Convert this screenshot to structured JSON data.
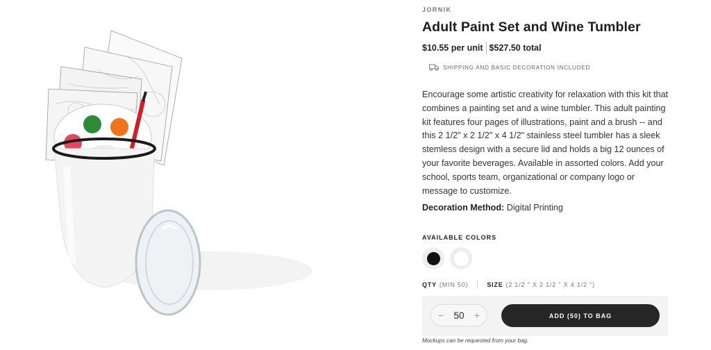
{
  "product": {
    "brand": "JORNIK",
    "title": "Adult Paint Set and Wine Tumbler",
    "unit_price": "$10.55 per unit",
    "total_price": "$527.50 total",
    "shipping_note": "SHIPPING AND BASIC DECORATION INCLUDED",
    "description": "Encourage some artistic creativity for relaxation with this kit that combines a painting set and a wine tumbler. This adult painting kit features four pages of illustrations, paint and a brush -- and this 2 1/2\" x 2 1/2\" x 4 1/2\" stainless steel tumbler has a sleek stemless design with a secure lid and holds a big 12 ounces of your favorite beverages. Available in assorted colors. Add your school, sports team, organizational or company logo or message to customize.",
    "decoration_label": "Decoration Method:",
    "decoration_value": "Digital Printing"
  },
  "colors": {
    "label": "AVAILABLE COLORS",
    "options": [
      "#111111",
      "#ffffff"
    ]
  },
  "options": {
    "qty_label": "QTY",
    "qty_min": "(MIN 50)",
    "size_label": "SIZE",
    "size_value": "(2 1/2 \" X 2 1/2 \" X 4 1/2 \")"
  },
  "cart": {
    "minus": "−",
    "plus": "+",
    "quantity": "50",
    "add_label": "ADD (50) TO BAG",
    "note": "Mockups can be requested from your bag."
  },
  "icons": {
    "shipping": "truck-icon"
  }
}
